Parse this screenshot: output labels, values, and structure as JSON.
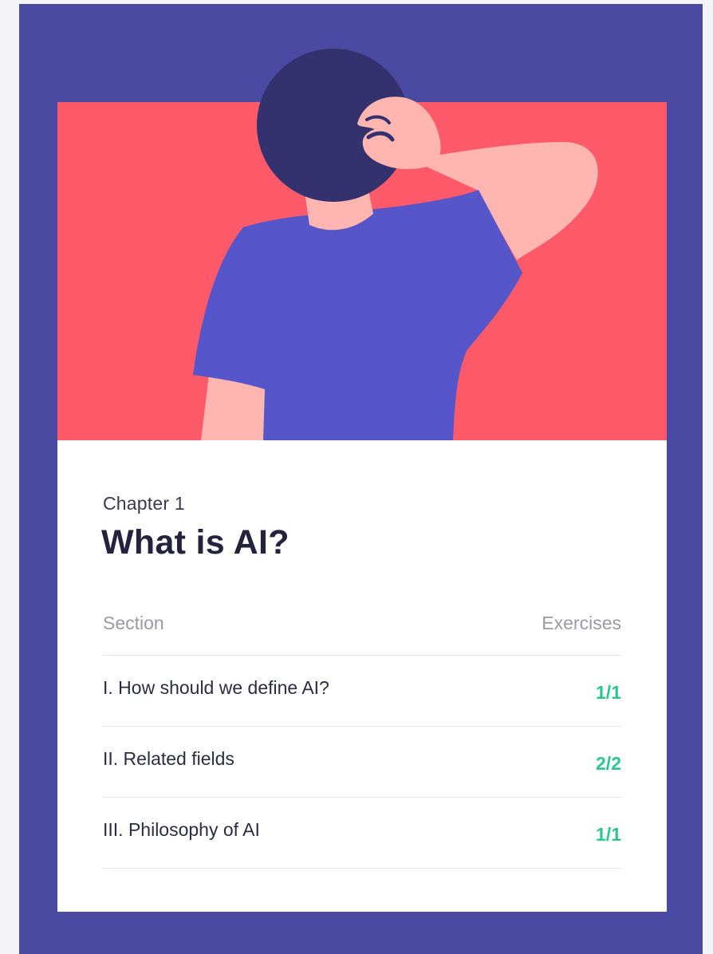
{
  "chapter": {
    "label": "Chapter 1",
    "title": "What is AI?"
  },
  "table": {
    "col_section": "Section",
    "col_exercises": "Exercises",
    "rows": [
      {
        "section": "I. How should we define AI?",
        "exercises": "1/1"
      },
      {
        "section": "II. Related fields",
        "exercises": "2/2"
      },
      {
        "section": "III. Philosophy of AI",
        "exercises": "1/1"
      }
    ]
  },
  "colors": {
    "frame": "#4a4aa2",
    "hero_background": "#ff5a6a",
    "shirt": "#5655c9",
    "hair": "#33316e",
    "skin": "#ffb6b0",
    "exercise_count": "#2cc68c"
  }
}
